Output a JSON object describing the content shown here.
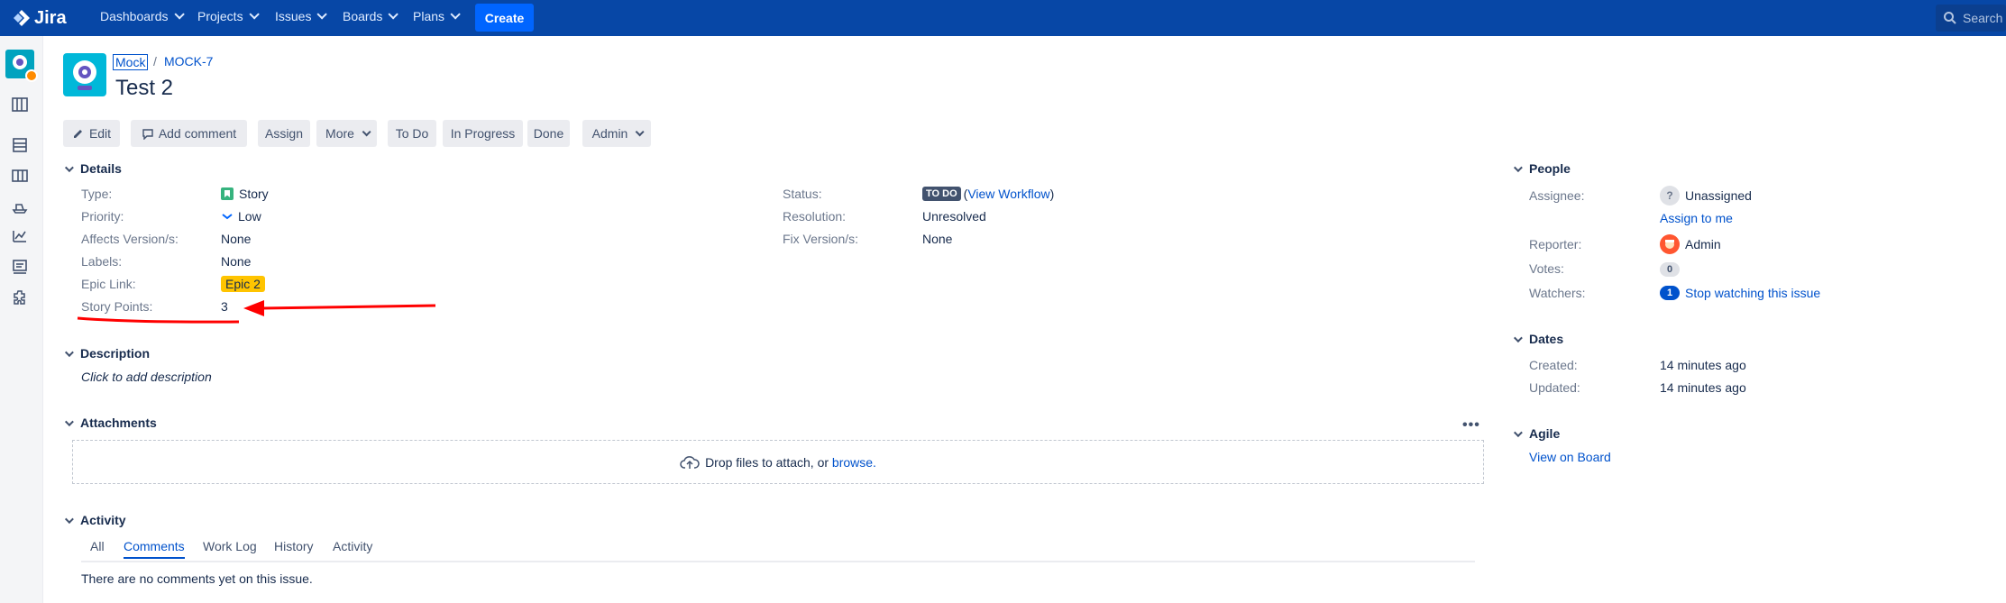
{
  "topnav": {
    "logo": "Jira",
    "items": [
      "Dashboards",
      "Projects",
      "Issues",
      "Boards",
      "Plans"
    ],
    "create": "Create",
    "search_placeholder": "Search"
  },
  "breadcrumb": {
    "project": "Mock",
    "separator": "/",
    "issue_key": "MOCK-7"
  },
  "issue_title": "Test 2",
  "toolbar": {
    "edit": "Edit",
    "add_comment": "Add comment",
    "assign": "Assign",
    "more": "More",
    "todo": "To Do",
    "in_progress": "In Progress",
    "done": "Done",
    "admin": "Admin"
  },
  "details": {
    "heading": "Details",
    "type_label": "Type:",
    "type_value": "Story",
    "priority_label": "Priority:",
    "priority_value": "Low",
    "affects_label": "Affects Version/s:",
    "affects_value": "None",
    "labels_label": "Labels:",
    "labels_value": "None",
    "epic_label": "Epic Link:",
    "epic_value": "Epic 2",
    "story_points_label": "Story Points:",
    "story_points_value": "3",
    "status_label": "Status:",
    "status_value": "TO DO",
    "status_paren_open": "(",
    "view_workflow": "View Workflow",
    "status_paren_close": ")",
    "resolution_label": "Resolution:",
    "resolution_value": "Unresolved",
    "fix_label": "Fix Version/s:",
    "fix_value": "None"
  },
  "description": {
    "heading": "Description",
    "placeholder": "Click to add description"
  },
  "attachments": {
    "heading": "Attachments",
    "drop_text": "Drop files to attach, or",
    "browse": "browse.",
    "more": "•••"
  },
  "activity": {
    "heading": "Activity",
    "tabs": [
      "All",
      "Comments",
      "Work Log",
      "History",
      "Activity"
    ],
    "active_tab": "Comments",
    "empty": "There are no comments yet on this issue."
  },
  "people": {
    "heading": "People",
    "assignee_label": "Assignee:",
    "assignee_value": "Unassigned",
    "assign_to_me": "Assign to me",
    "reporter_label": "Reporter:",
    "reporter_value": "Admin",
    "votes_label": "Votes:",
    "votes_value": "0",
    "watchers_label": "Watchers:",
    "watchers_count": "1",
    "watchers_action": "Stop watching this issue"
  },
  "dates": {
    "heading": "Dates",
    "created_label": "Created:",
    "created_value": "14 minutes ago",
    "updated_label": "Updated:",
    "updated_value": "14 minutes ago"
  },
  "agile": {
    "heading": "Agile",
    "view_on_board": "View on Board"
  },
  "colors": {
    "nav_bg": "#0747a6",
    "create_bg": "#0065ff",
    "link": "#0052cc",
    "epic": "#ffc400",
    "annotation": "#ff0000"
  }
}
